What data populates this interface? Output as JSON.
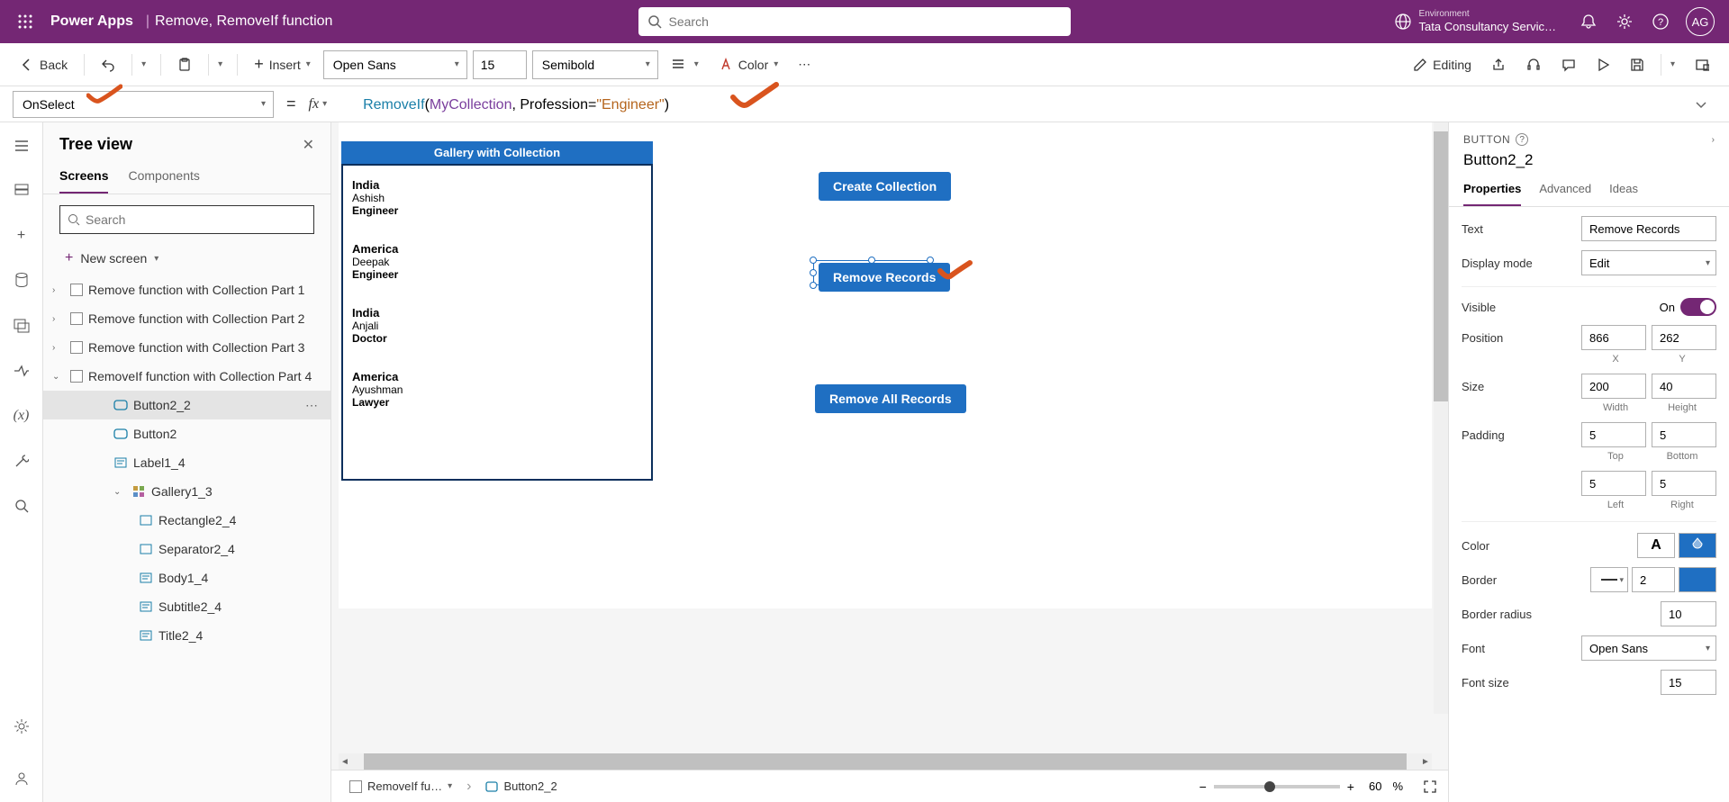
{
  "header": {
    "app": "Power Apps",
    "doc": "Remove, RemoveIf function",
    "search_placeholder": "Search",
    "env_label": "Environment",
    "env_name": "Tata Consultancy Servic…",
    "avatar": "AG"
  },
  "toolbar": {
    "back": "Back",
    "insert": "Insert",
    "font": "Open Sans",
    "size": "15",
    "weight": "Semibold",
    "color": "Color",
    "editing": "Editing"
  },
  "formula": {
    "property": "OnSelect",
    "fn": "RemoveIf",
    "ident": "MyCollection",
    "rest1": ", Profession=",
    "str": "\"Engineer\"",
    "close": ")"
  },
  "tree": {
    "title": "Tree view",
    "tab_screens": "Screens",
    "tab_components": "Components",
    "search_placeholder": "Search",
    "new_screen": "New screen",
    "items": [
      {
        "label": "Remove function with Collection Part 1",
        "level": 0,
        "chev": "›",
        "cb": true,
        "icon": ""
      },
      {
        "label": "Remove function with Collection Part 2",
        "level": 0,
        "chev": "›",
        "cb": true,
        "icon": ""
      },
      {
        "label": "Remove function with Collection Part 3",
        "level": 0,
        "chev": "›",
        "cb": true,
        "icon": ""
      },
      {
        "label": "RemoveIf function with Collection Part 4",
        "level": 0,
        "chev": "⌄",
        "cb": true,
        "icon": ""
      },
      {
        "label": "Button2_2",
        "level": 1,
        "icon": "btn",
        "selected": true,
        "more": true
      },
      {
        "label": "Button2",
        "level": 1,
        "icon": "btn"
      },
      {
        "label": "Label1_4",
        "level": 1,
        "icon": "lbl"
      },
      {
        "label": "Gallery1_3",
        "level": 1,
        "icon": "gal",
        "chev": "⌄"
      },
      {
        "label": "Rectangle2_4",
        "level": 2,
        "icon": "rect"
      },
      {
        "label": "Separator2_4",
        "level": 2,
        "icon": "rect"
      },
      {
        "label": "Body1_4",
        "level": 2,
        "icon": "lbl"
      },
      {
        "label": "Subtitle2_4",
        "level": 2,
        "icon": "lbl"
      },
      {
        "label": "Title2_4",
        "level": 2,
        "icon": "lbl"
      }
    ]
  },
  "canvas": {
    "gallery_title": "Gallery with Collection",
    "records": [
      {
        "title": "India",
        "sub": "Ashish",
        "body": "Engineer"
      },
      {
        "title": "America",
        "sub": "Deepak",
        "body": "Engineer"
      },
      {
        "title": "India",
        "sub": "Anjali",
        "body": "Doctor"
      },
      {
        "title": "America",
        "sub": "Ayushman",
        "body": "Lawyer"
      }
    ],
    "btn_create": "Create Collection",
    "btn_remove": "Remove Records",
    "btn_remove_all": "Remove All Records",
    "footer": {
      "bc1": "RemoveIf fu…",
      "bc2": "Button2_2",
      "zoom_val": "60",
      "zoom_pct": "%"
    }
  },
  "props": {
    "type": "BUTTON",
    "name": "Button2_2",
    "tab_props": "Properties",
    "tab_adv": "Advanced",
    "tab_ideas": "Ideas",
    "text_label": "Text",
    "text_val": "Remove Records",
    "display_label": "Display mode",
    "display_val": "Edit",
    "visible_label": "Visible",
    "visible_on": "On",
    "pos_label": "Position",
    "pos_x": "866",
    "pos_y": "262",
    "pos_xl": "X",
    "pos_yl": "Y",
    "size_label": "Size",
    "size_w": "200",
    "size_h": "40",
    "size_wl": "Width",
    "size_hl": "Height",
    "pad_label": "Padding",
    "pad_t": "5",
    "pad_b": "5",
    "pad_l": "5",
    "pad_r": "5",
    "pad_tl": "Top",
    "pad_bl": "Bottom",
    "pad_ll": "Left",
    "pad_rl": "Right",
    "color_label": "Color",
    "border_label": "Border",
    "border_val": "2",
    "radius_label": "Border radius",
    "radius_val": "10",
    "font_label": "Font",
    "font_val": "Open Sans",
    "fsize_label": "Font size",
    "fsize_val": "15"
  }
}
